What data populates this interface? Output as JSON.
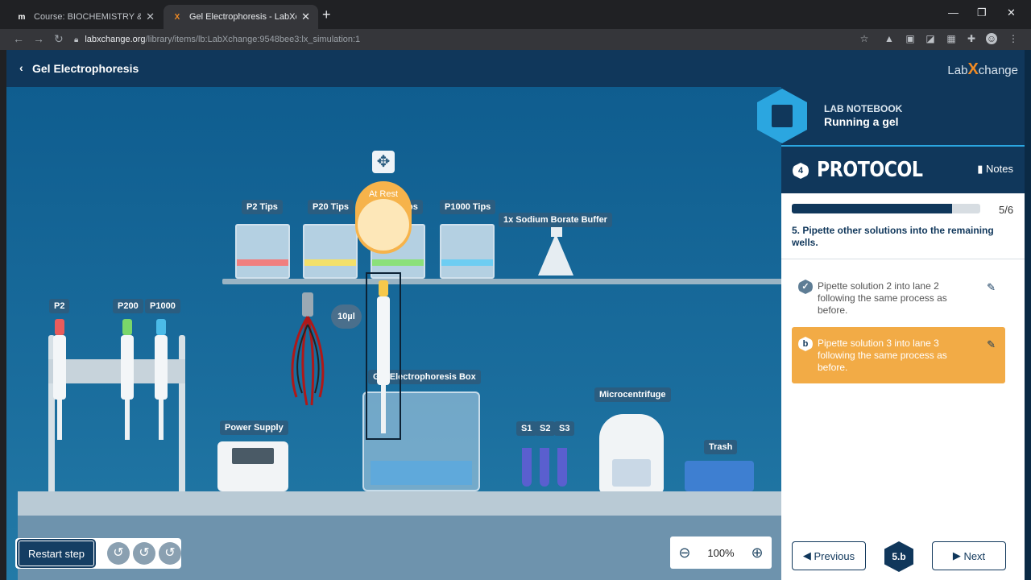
{
  "browser": {
    "tabs": [
      {
        "title": "Course: BIOCHEMISTRY & MOLE",
        "active": false
      },
      {
        "title": "Gel Electrophoresis - LabXchange",
        "active": true
      }
    ],
    "url_host": "labxchange.org",
    "url_path": "/library/items/lb:LabXchange:9548bee3:lx_simulation:1"
  },
  "header": {
    "title": "Gel Electrophoresis",
    "brand_pre": "Lab",
    "brand_x": "X",
    "brand_post": "change"
  },
  "scene": {
    "labels": {
      "p2_tips": "P2 Tips",
      "p20_tips": "P20 Tips",
      "p200_tips_partial": "ps",
      "p1000_tips": "P1000 Tips",
      "buffer": "1x Sodium Borate Buffer",
      "p2": "P2",
      "p200": "P200",
      "p1000": "P1000",
      "gel_box": "Gel Electrophoresis Box",
      "power_supply": "Power Supply",
      "s1": "S1",
      "s2": "S2",
      "s3": "S3",
      "microcentrifuge": "Microcentrifuge",
      "trash": "Trash"
    },
    "pipette_state": "At Rest",
    "volume": "10µl"
  },
  "controls": {
    "restart": "Restart step",
    "zoom": "100%"
  },
  "notebook": {
    "title": "LAB NOTEBOOK",
    "subtitle": "Running a gel"
  },
  "protocol": {
    "number": "4",
    "title": "PROTOCOL",
    "notes": "Notes",
    "progress": {
      "current": 5,
      "total": 6,
      "fraction": 0.85,
      "label": "5/6"
    },
    "step_title": "5. Pipette other solutions into the remaining wells.",
    "substeps": [
      {
        "mark": "✓",
        "text": "Pipette solution 2 into lane 2 following the same process as before.",
        "status": "done"
      },
      {
        "mark": "b",
        "text": "Pipette solution 3 into lane 3 following the same process as before.",
        "status": "current"
      }
    ],
    "previous": "Previous",
    "step_badge": "5.b",
    "next": "Next"
  },
  "colors": {
    "navy": "#10375b",
    "accent_blue": "#2ba6e0",
    "current_step": "#f2ab46"
  }
}
